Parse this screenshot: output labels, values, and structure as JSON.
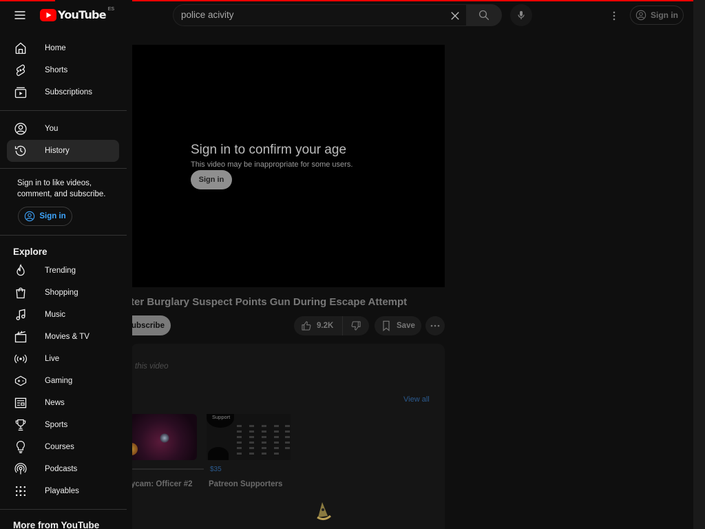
{
  "header": {
    "search_value": "police acivity",
    "sign_in_label": "Sign in",
    "logo_text": "YouTube",
    "logo_country": "ES"
  },
  "player": {
    "age_title": "Sign in to confirm your age",
    "age_subtitle": "This video may be inappropriate for some users.",
    "age_signin_label": "Sign in"
  },
  "video": {
    "title": "ter Burglary Suspect Points Gun During Escape Attempt",
    "subscribe_label": "ubscribe",
    "likes": "9.2K",
    "save_label": "Save",
    "description_text": "this video",
    "view_all_label": "View all",
    "related": [
      {
        "title": "ycam: Officer #2"
      },
      {
        "title": "Patreon Supporters",
        "count": "$35",
        "thumb_caption": "Support"
      }
    ]
  },
  "drawer": {
    "items_main": [
      {
        "label": "Home",
        "icon": "home-icon"
      },
      {
        "label": "Shorts",
        "icon": "shorts-icon"
      },
      {
        "label": "Subscriptions",
        "icon": "subscriptions-icon"
      }
    ],
    "items_you": [
      {
        "label": "You",
        "icon": "account-icon"
      },
      {
        "label": "History",
        "icon": "history-icon",
        "active": true
      }
    ],
    "signin_note": "Sign in to like videos, comment, and subscribe.",
    "signin_label": "Sign in",
    "explore_title": "Explore",
    "explore_items": [
      {
        "label": "Trending",
        "icon": "trending-icon"
      },
      {
        "label": "Shopping",
        "icon": "shopping-icon"
      },
      {
        "label": "Music",
        "icon": "music-icon"
      },
      {
        "label": "Movies & TV",
        "icon": "movies-icon"
      },
      {
        "label": "Live",
        "icon": "live-icon"
      },
      {
        "label": "Gaming",
        "icon": "gaming-icon"
      },
      {
        "label": "News",
        "icon": "news-icon"
      },
      {
        "label": "Sports",
        "icon": "sports-icon"
      },
      {
        "label": "Courses",
        "icon": "courses-icon"
      },
      {
        "label": "Podcasts",
        "icon": "podcasts-icon"
      },
      {
        "label": "Playables",
        "icon": "playables-icon"
      }
    ],
    "more_title": "More from YouTube"
  },
  "colors": {
    "background": "#0f0f0f",
    "accent_red": "#ff0000",
    "link_blue": "#3ea6ff",
    "active_item": "#272727"
  }
}
